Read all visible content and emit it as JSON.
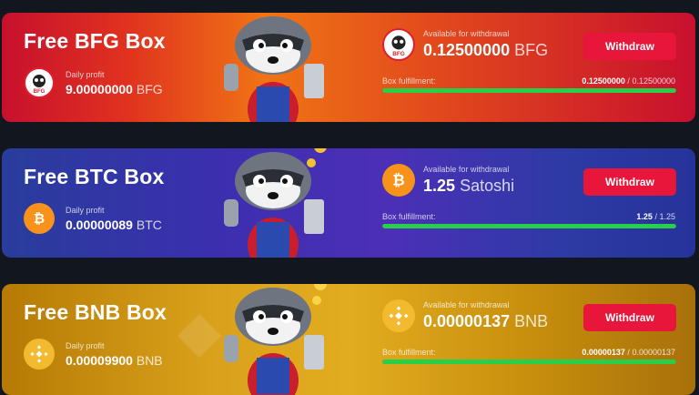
{
  "boxes": [
    {
      "id": "bfg",
      "title": "Free BFG Box",
      "coin_icon": "bfg-logo-icon",
      "coin_text": "BFG",
      "daily_label": "Daily profit",
      "daily_value": "9.00000000",
      "daily_unit": "BFG",
      "available_label": "Available for withdrawal",
      "available_value": "0.12500000",
      "available_unit": "BFG",
      "withdraw_label": "Withdraw",
      "fulfillment_label": "Box fulfillment:",
      "fulfillment_current": "0.12500000",
      "fulfillment_sep": "/",
      "fulfillment_total": "0.12500000",
      "fulfillment_progress": 1.0
    },
    {
      "id": "btc",
      "title": "Free BTC Box",
      "coin_icon": "bitcoin-icon",
      "daily_label": "Daily profit",
      "daily_value": "0.00000089",
      "daily_unit": "BTC",
      "available_label": "Available for withdrawal",
      "available_value": "1.25",
      "available_unit": "Satoshi",
      "withdraw_label": "Withdraw",
      "fulfillment_label": "Box fulfillment:",
      "fulfillment_current": "1.25",
      "fulfillment_sep": "/",
      "fulfillment_total": "1.25",
      "fulfillment_progress": 1.0
    },
    {
      "id": "bnb",
      "title": "Free BNB Box",
      "coin_icon": "bnb-icon",
      "daily_label": "Daily profit",
      "daily_value": "0.00009900",
      "daily_unit": "BNB",
      "available_label": "Available for withdrawal",
      "available_value": "0.00000137",
      "available_unit": "BNB",
      "withdraw_label": "Withdraw",
      "fulfillment_label": "Box fulfillment:",
      "fulfillment_current": "0.00000137",
      "fulfillment_sep": "/",
      "fulfillment_total": "0.00000137",
      "fulfillment_progress": 1.0
    }
  ],
  "colors": {
    "withdraw_button": "#e8163b",
    "progress_fill": "#28d04a",
    "bitcoin": "#f7931a",
    "bnb": "#f3ba2f"
  }
}
